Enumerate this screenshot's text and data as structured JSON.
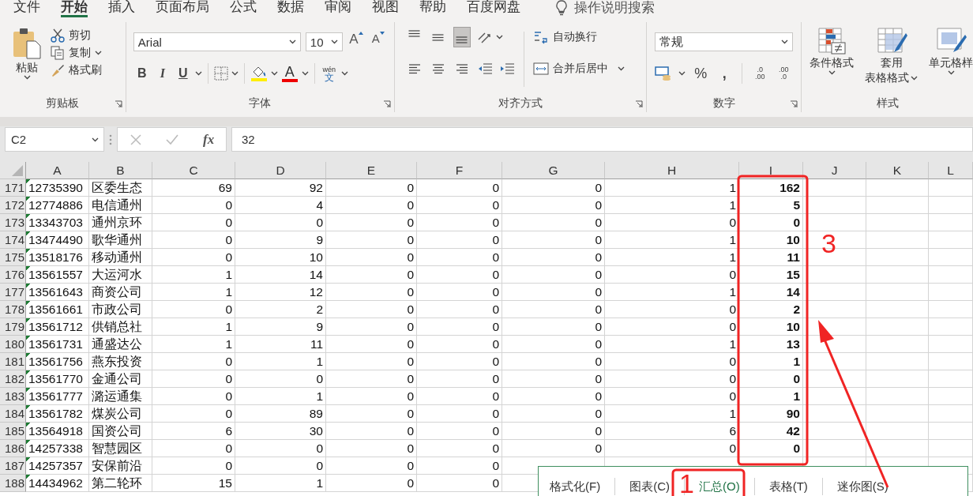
{
  "menu_tabs": [
    {
      "label": "文件",
      "selected": false
    },
    {
      "label": "开始",
      "selected": true
    },
    {
      "label": "插入",
      "selected": false
    },
    {
      "label": "页面布局",
      "selected": false
    },
    {
      "label": "公式",
      "selected": false
    },
    {
      "label": "数据",
      "selected": false
    },
    {
      "label": "审阅",
      "selected": false
    },
    {
      "label": "视图",
      "selected": false
    },
    {
      "label": "帮助",
      "selected": false
    },
    {
      "label": "百度网盘",
      "selected": false
    }
  ],
  "tell_me": "操作说明搜索",
  "ribbon": {
    "clipboard": {
      "paste": "粘贴",
      "cut": "剪切",
      "copy": "复制",
      "format_painter": "格式刷",
      "label": "剪贴板"
    },
    "font": {
      "font_name": "Arial",
      "font_size": "10",
      "grow": "A",
      "shrink": "A",
      "style_buttons": [
        "B",
        "I",
        "U"
      ],
      "font_color": "A",
      "phonetic_top": "wén",
      "phonetic_bottom": "文",
      "label": "字体"
    },
    "alignment": {
      "vertical": [
        {
          "kind": "top",
          "pressed": false
        },
        {
          "kind": "middle",
          "pressed": false
        },
        {
          "kind": "bottom",
          "pressed": true
        }
      ],
      "horizontal": [
        {
          "kind": "left",
          "pressed": false
        },
        {
          "kind": "center",
          "pressed": false
        },
        {
          "kind": "right",
          "pressed": false
        }
      ],
      "wrap_text": "自动换行",
      "merge_center": "合并后居中",
      "label": "对齐方式"
    },
    "number": {
      "format": "常规",
      "percent": "%",
      "comma": ",",
      "increase_decimal": [
        ".0",
        ".00"
      ],
      "decrease_decimal": [
        ".00",
        ".0"
      ],
      "label": "数字"
    },
    "styles": {
      "conditional_format": "条件格式",
      "table_format": [
        "套用",
        "表格格式"
      ],
      "cell_styles": "单元格样",
      "label": "样式"
    }
  },
  "formula_bar": {
    "name_box": "C2",
    "fx": "fx",
    "formula": "32"
  },
  "columns": [
    {
      "label": "A",
      "kind": "text",
      "bold": false
    },
    {
      "label": "B",
      "kind": "text",
      "bold": false
    },
    {
      "label": "C",
      "kind": "number",
      "bold": false
    },
    {
      "label": "D",
      "kind": "number",
      "bold": false
    },
    {
      "label": "E",
      "kind": "number",
      "bold": false
    },
    {
      "label": "F",
      "kind": "number",
      "bold": false
    },
    {
      "label": "G",
      "kind": "number",
      "bold": false
    },
    {
      "label": "H",
      "kind": "number",
      "bold": false
    },
    {
      "label": "I",
      "kind": "number",
      "bold": true
    },
    {
      "label": "J",
      "kind": "number"
    },
    {
      "label": "K",
      "kind": "number"
    },
    {
      "label": "L",
      "kind": "number"
    }
  ],
  "rows": [
    {
      "row": "171",
      "flagged": true,
      "cells": [
        "12735390",
        "区委生态",
        "69",
        "92",
        "0",
        "0",
        "0",
        "1",
        "162"
      ]
    },
    {
      "row": "172",
      "flagged": true,
      "cells": [
        "12774886",
        "电信通州",
        "0",
        "4",
        "0",
        "0",
        "0",
        "1",
        "5"
      ]
    },
    {
      "row": "173",
      "flagged": true,
      "cells": [
        "13343703",
        "通州京环",
        "0",
        "0",
        "0",
        "0",
        "0",
        "0",
        "0"
      ]
    },
    {
      "row": "174",
      "flagged": true,
      "cells": [
        "13474490",
        "歌华通州",
        "0",
        "9",
        "0",
        "0",
        "0",
        "1",
        "10"
      ]
    },
    {
      "row": "175",
      "flagged": true,
      "cells": [
        "13518176",
        "移动通州",
        "0",
        "10",
        "0",
        "0",
        "0",
        "1",
        "11"
      ]
    },
    {
      "row": "176",
      "flagged": true,
      "cells": [
        "13561557",
        "大运河水",
        "1",
        "14",
        "0",
        "0",
        "0",
        "0",
        "15"
      ]
    },
    {
      "row": "177",
      "flagged": true,
      "cells": [
        "13561643",
        "商资公司",
        "1",
        "12",
        "0",
        "0",
        "0",
        "1",
        "14"
      ]
    },
    {
      "row": "178",
      "flagged": true,
      "cells": [
        "13561661",
        "市政公司",
        "0",
        "2",
        "0",
        "0",
        "0",
        "0",
        "2"
      ]
    },
    {
      "row": "179",
      "flagged": true,
      "cells": [
        "13561712",
        "供销总社",
        "1",
        "9",
        "0",
        "0",
        "0",
        "0",
        "10"
      ]
    },
    {
      "row": "180",
      "flagged": true,
      "cells": [
        "13561731",
        "通盛达公",
        "1",
        "11",
        "0",
        "0",
        "0",
        "1",
        "13"
      ]
    },
    {
      "row": "181",
      "flagged": true,
      "cells": [
        "13561756",
        "燕东投资",
        "0",
        "1",
        "0",
        "0",
        "0",
        "0",
        "1"
      ]
    },
    {
      "row": "182",
      "flagged": true,
      "cells": [
        "13561770",
        "金通公司",
        "0",
        "0",
        "0",
        "0",
        "0",
        "0",
        "0"
      ]
    },
    {
      "row": "183",
      "flagged": true,
      "cells": [
        "13561777",
        "潞运通集",
        "0",
        "1",
        "0",
        "0",
        "0",
        "0",
        "1"
      ]
    },
    {
      "row": "184",
      "flagged": true,
      "cells": [
        "13561782",
        "煤炭公司",
        "0",
        "89",
        "0",
        "0",
        "0",
        "1",
        "90"
      ]
    },
    {
      "row": "185",
      "flagged": true,
      "cells": [
        "13564918",
        "国资公司",
        "6",
        "30",
        "0",
        "0",
        "0",
        "6",
        "42"
      ]
    },
    {
      "row": "186",
      "flagged": true,
      "cells": [
        "14257338",
        "智慧园区",
        "0",
        "0",
        "0",
        "0",
        "0",
        "0",
        "0"
      ]
    },
    {
      "row": "187",
      "flagged": true,
      "cells": [
        "14257357",
        "安保前沿",
        "0",
        "0",
        "0",
        "0",
        null,
        null,
        null
      ]
    },
    {
      "row": "188",
      "flagged": true,
      "cells": [
        "14434962",
        "第二轮环",
        "15",
        "1",
        "0",
        "0",
        null,
        null,
        null
      ]
    }
  ],
  "quick_analysis": {
    "tabs": [
      {
        "label": "格式化(F)",
        "selected": false
      },
      {
        "label": "图表(C)",
        "selected": false
      },
      {
        "label": "汇总(O)",
        "selected": true
      },
      {
        "label": "表格(T)",
        "selected": false
      },
      {
        "label": "迷你图(S)",
        "selected": false
      }
    ]
  },
  "annotations": [
    {
      "kind": "column-box"
    },
    {
      "kind": "number",
      "text": "3"
    },
    {
      "kind": "arrow"
    },
    {
      "kind": "tab-box"
    },
    {
      "kind": "number",
      "text": "1"
    }
  ]
}
